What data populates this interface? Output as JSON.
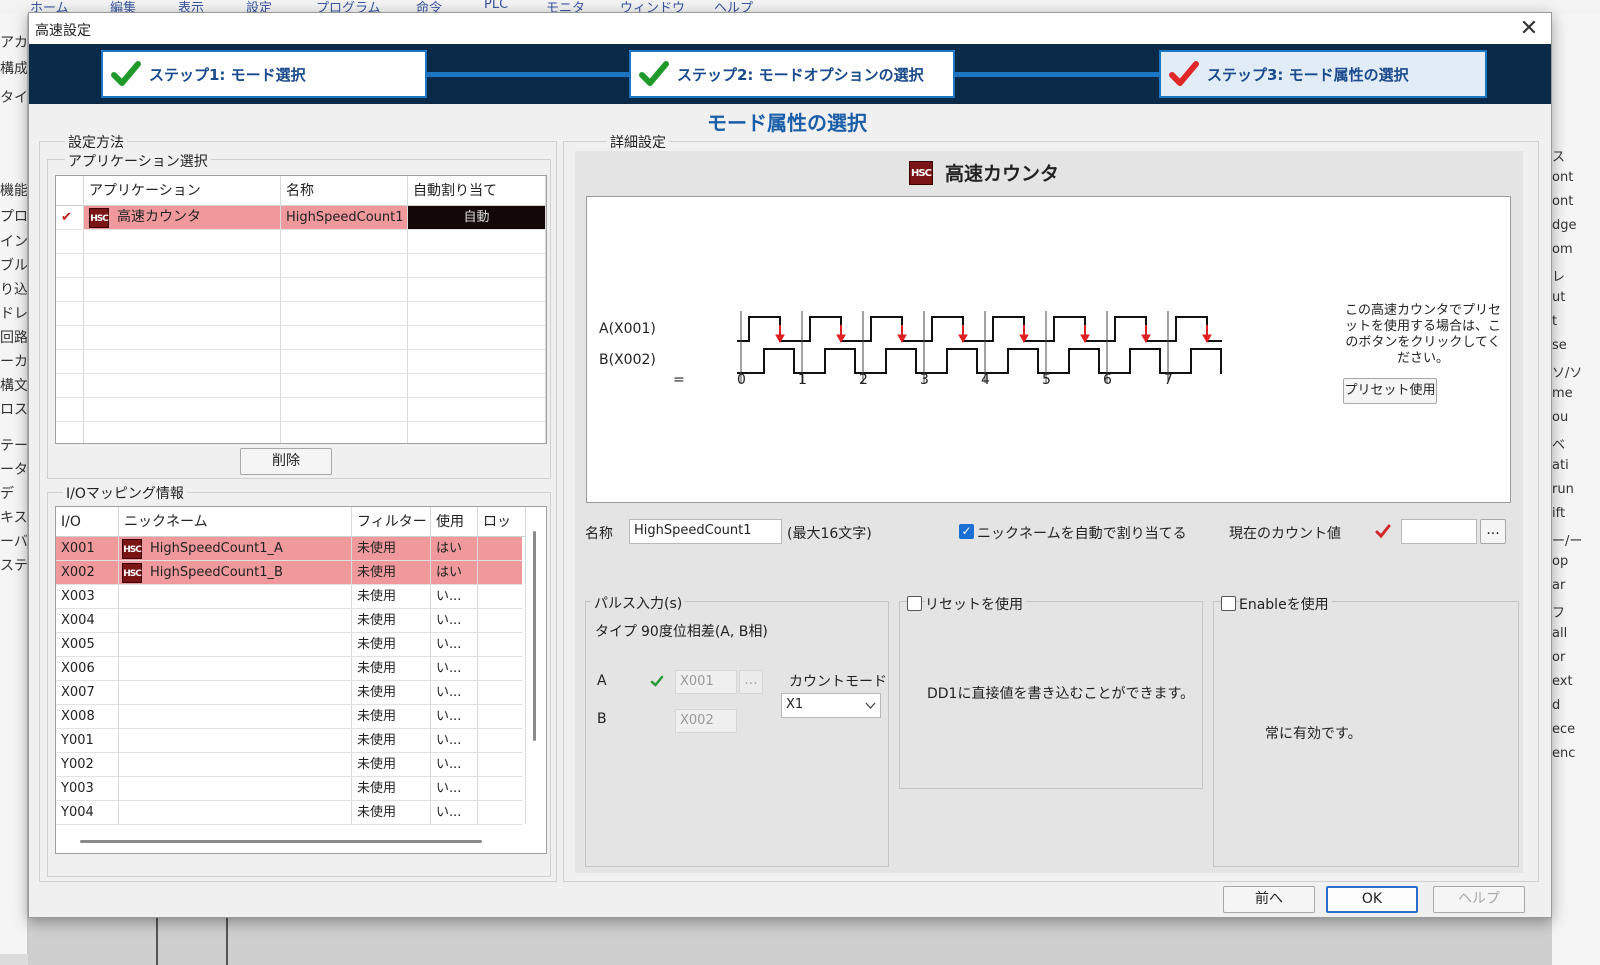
{
  "bg_menu": [
    "ホーム",
    "編集",
    "表示",
    "設定",
    "プログラム",
    "命令",
    "PLC",
    "モニタ",
    "ウィンドウ",
    "ヘルプ"
  ],
  "bg_left_items": [
    "アカ",
    "構成",
    "タイム",
    "機能",
    "プロ",
    "イン",
    "ブル",
    "り込",
    "ドレ",
    "回路",
    "ーカ",
    "構文",
    "ロス",
    "テー",
    "ータ",
    "デ",
    "キス",
    "ーバ",
    "ステ"
  ],
  "bg_right_items": [
    "ス",
    "ont",
    "ont",
    "dge",
    "om",
    "レ",
    "ut",
    "t",
    "se",
    "ソ/ソ",
    "me",
    "ou",
    "ベ",
    "ati",
    "run",
    "ift",
    "ー/ー",
    "op",
    "ar",
    "フ",
    "all",
    "or",
    "ext",
    "d",
    "ece",
    "enc"
  ],
  "dialog": {
    "title": "高速設定",
    "close": "✕",
    "steps": [
      "ステップ1: モード選択",
      "ステップ2: モードオプションの選択",
      "ステップ3: モード属性の選択"
    ],
    "heading": "モード属性の選択"
  },
  "left": {
    "method_label": "設定方法",
    "app_group_label": "アプリケーション選択",
    "app_headers": [
      "アプリケーション",
      "名称",
      "自動割り当て"
    ],
    "app_rows": [
      {
        "check": "✔",
        "icon": "HSC",
        "app": "高速カウンタ",
        "name": "HighSpeedCount1",
        "auto": "自動"
      }
    ],
    "delete_button": "削除",
    "io_group_label": "I/Oマッピング情報",
    "io_headers": [
      "I/O",
      "ニックネーム",
      "フィルター",
      "使用",
      "ロッ"
    ],
    "io_rows": [
      {
        "io": "X001",
        "icon": "HSC",
        "nick": "HighSpeedCount1_A",
        "filter": "未使用",
        "use": "はい",
        "lock": ""
      },
      {
        "io": "X002",
        "icon": "HSC",
        "nick": "HighSpeedCount1_B",
        "filter": "未使用",
        "use": "はい",
        "lock": ""
      },
      {
        "io": "X003",
        "icon": "",
        "nick": "",
        "filter": "未使用",
        "use": "い...",
        "lock": ""
      },
      {
        "io": "X004",
        "icon": "",
        "nick": "",
        "filter": "未使用",
        "use": "い...",
        "lock": ""
      },
      {
        "io": "X005",
        "icon": "",
        "nick": "",
        "filter": "未使用",
        "use": "い...",
        "lock": ""
      },
      {
        "io": "X006",
        "icon": "",
        "nick": "",
        "filter": "未使用",
        "use": "い...",
        "lock": ""
      },
      {
        "io": "X007",
        "icon": "",
        "nick": "",
        "filter": "未使用",
        "use": "い...",
        "lock": ""
      },
      {
        "io": "X008",
        "icon": "",
        "nick": "",
        "filter": "未使用",
        "use": "い...",
        "lock": ""
      },
      {
        "io": "Y001",
        "icon": "",
        "nick": "",
        "filter": "未使用",
        "use": "い...",
        "lock": ""
      },
      {
        "io": "Y002",
        "icon": "",
        "nick": "",
        "filter": "未使用",
        "use": "い...",
        "lock": ""
      },
      {
        "io": "Y003",
        "icon": "",
        "nick": "",
        "filter": "未使用",
        "use": "い...",
        "lock": ""
      },
      {
        "io": "Y004",
        "icon": "",
        "nick": "",
        "filter": "未使用",
        "use": "い...",
        "lock": ""
      }
    ]
  },
  "detail": {
    "label": "詳細設定",
    "title": "高速カウンタ",
    "title_icon": "HSC",
    "signal_a": "A(X001)",
    "signal_b": "B(X002)",
    "equals": "=",
    "count_labels": [
      "0",
      "1",
      "2",
      "3",
      "4",
      "5",
      "6",
      "7"
    ],
    "preset_note": "この高速カウンタでプリセットを使用する場合は、このボタンをクリックしてください。",
    "preset_button": "プリセット使用",
    "name_label": "名称",
    "name_value": "HighSpeedCount1",
    "name_max": "(最大16文字)",
    "auto_nick": "ニックネームを自動で割り当てる",
    "current_count": "現在のカウント値",
    "ellipsis": "...",
    "pulse_label": "パルス入力(s)",
    "type_label": "タイプ",
    "type_value": "90度位相差(A, B相)",
    "a_label": "A",
    "b_label": "B",
    "a_value": "X001",
    "b_value": "X002",
    "count_mode_label": "カウントモード",
    "count_mode_value": "X1",
    "reset_label": "リセットを使用",
    "reset_note": "DD1に直接値を書き込むことができます。",
    "enable_label": "Enableを使用",
    "enable_note": "常に有効です。"
  },
  "buttons": {
    "prev": "前へ",
    "ok": "OK",
    "help": "ヘルプ"
  },
  "colors": {
    "selected_row": "#f0999c",
    "accent": "#1a5ea8",
    "pulse_arrow": "#e02020",
    "hsc_icon": "#7b1515"
  }
}
